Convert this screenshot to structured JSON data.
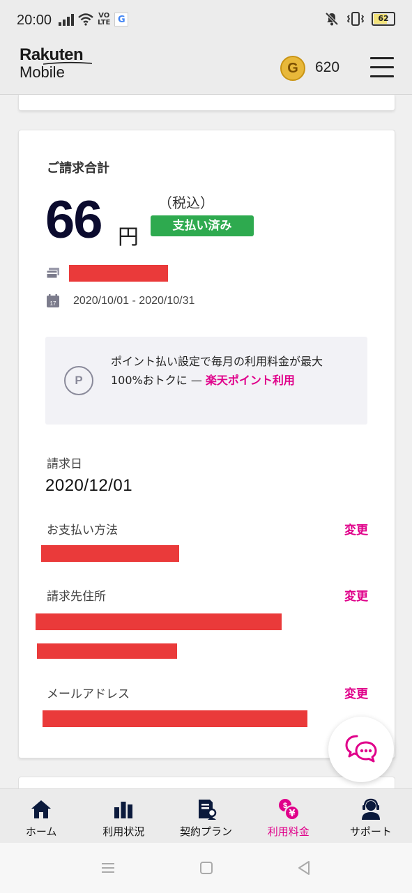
{
  "status_bar": {
    "time": "20:00",
    "volte": [
      "VO",
      "LTE"
    ],
    "g_badge": "G",
    "battery": "62",
    "battery_level": 0.62
  },
  "header": {
    "logo_line1": "Rakuten",
    "logo_line2": "Mobile",
    "coin_label": "G",
    "points": "620",
    "menu_icon": "hamburger-menu-icon"
  },
  "billing": {
    "title": "ご請求合計",
    "amount": "66",
    "unit": "円",
    "tax_note": "（税込）",
    "status_badge": "支払い済み",
    "period": "2020/10/01 - 2020/10/31"
  },
  "promo": {
    "icon": "P",
    "text": "ポイント払い設定で毎月の利用料金が最大100%おトクに — ",
    "link": "楽天ポイント利用"
  },
  "fields": {
    "billing_date_label": "請求日",
    "billing_date": "2020/12/01",
    "payment_method_label": "お支払い方法",
    "billing_address_label": "請求先住所",
    "email_label": "メールアドレス",
    "change": "変更"
  },
  "bottom_nav": [
    {
      "label": "ホーム",
      "icon": "home-icon"
    },
    {
      "label": "利用状況",
      "icon": "bar-chart-icon"
    },
    {
      "label": "契約プラン",
      "icon": "contract-icon"
    },
    {
      "label": "利用料金",
      "icon": "yen-fee-icon",
      "active": true
    },
    {
      "label": "サポート",
      "icon": "support-icon"
    }
  ],
  "colors": {
    "accent": "#e0008a",
    "paid_green": "#2eaa4f",
    "amount_navy": "#0b0b2e",
    "redaction": "#ea3a3a",
    "coin_gold": "#e8b83a"
  }
}
